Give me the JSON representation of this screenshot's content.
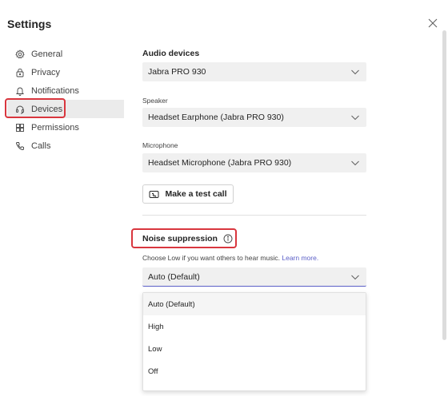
{
  "header": {
    "title": "Settings",
    "close_icon": "close-icon"
  },
  "sidebar": {
    "items": [
      {
        "label": "General",
        "icon": "gear-icon"
      },
      {
        "label": "Privacy",
        "icon": "lock-icon"
      },
      {
        "label": "Notifications",
        "icon": "bell-icon"
      },
      {
        "label": "Devices",
        "icon": "headset-icon",
        "selected": true
      },
      {
        "label": "Permissions",
        "icon": "grid-icon"
      },
      {
        "label": "Calls",
        "icon": "phone-icon"
      }
    ]
  },
  "audio": {
    "title": "Audio devices",
    "device_value": "Jabra PRO 930",
    "speaker_label": "Speaker",
    "speaker_value": "Headset Earphone (Jabra PRO 930)",
    "microphone_label": "Microphone",
    "microphone_value": "Headset Microphone (Jabra PRO 930)",
    "test_call_label": "Make a test call"
  },
  "noise": {
    "title": "Noise suppression",
    "help_text": "Choose Low if you want others to hear music.",
    "learn_more": "Learn more.",
    "selected": "Auto (Default)",
    "options": [
      "Auto (Default)",
      "High",
      "Low",
      "Off"
    ]
  },
  "colors": {
    "accent": "#5b5fc7",
    "highlight_box": "#d9363e"
  }
}
